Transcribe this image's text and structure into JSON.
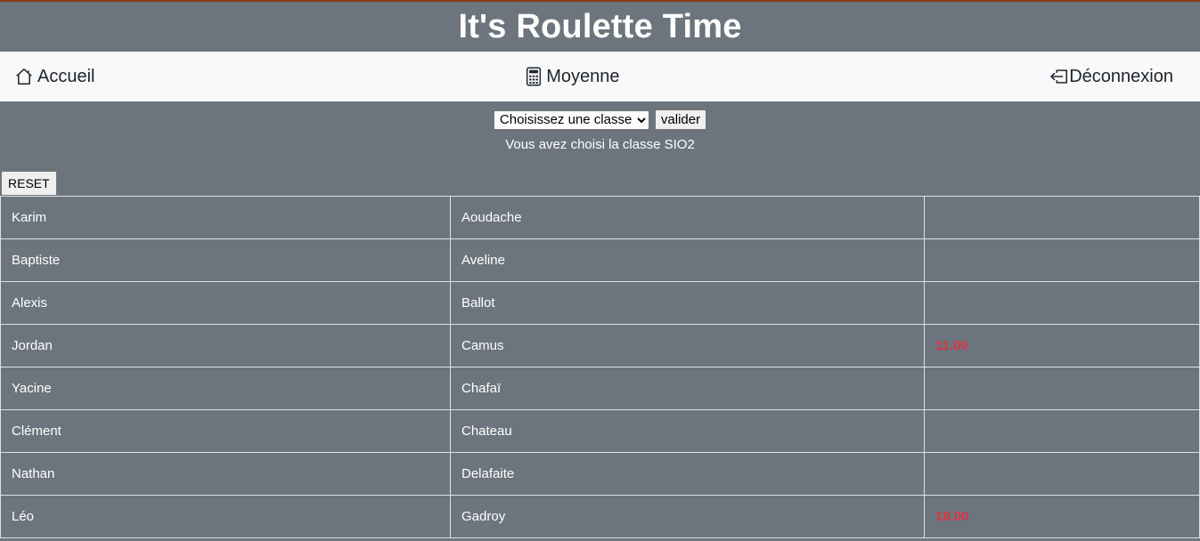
{
  "header": {
    "title": "It's Roulette Time"
  },
  "nav": {
    "home": {
      "label": "Accueil",
      "icon": "house-icon"
    },
    "average": {
      "label": "Moyenne",
      "icon": "calculator-icon"
    },
    "logout": {
      "label": "Déconnexion",
      "icon": "box-arrow-left-icon"
    }
  },
  "controls": {
    "select_value": "Choisissez une classe",
    "validate_label": "valider",
    "chosen_text": "Vous avez choisi la classe SIO2",
    "reset_label": "RESET"
  },
  "students": [
    {
      "first": "Karim",
      "last": "Aoudache",
      "grade": ""
    },
    {
      "first": "Baptiste",
      "last": "Aveline",
      "grade": ""
    },
    {
      "first": "Alexis",
      "last": "Ballot",
      "grade": ""
    },
    {
      "first": "Jordan",
      "last": "Camus",
      "grade": "11.00"
    },
    {
      "first": "Yacine",
      "last": "Chafaï",
      "grade": ""
    },
    {
      "first": "Clément",
      "last": "Chateau",
      "grade": ""
    },
    {
      "first": "Nathan",
      "last": "Delafaite",
      "grade": ""
    },
    {
      "first": "Léo",
      "last": "Gadroy",
      "grade": "18.00"
    }
  ],
  "colors": {
    "background": "#6c757d",
    "navbar": "#f8f9fa",
    "grade": "#dc3545",
    "accent_line": "#8a3b1c"
  }
}
